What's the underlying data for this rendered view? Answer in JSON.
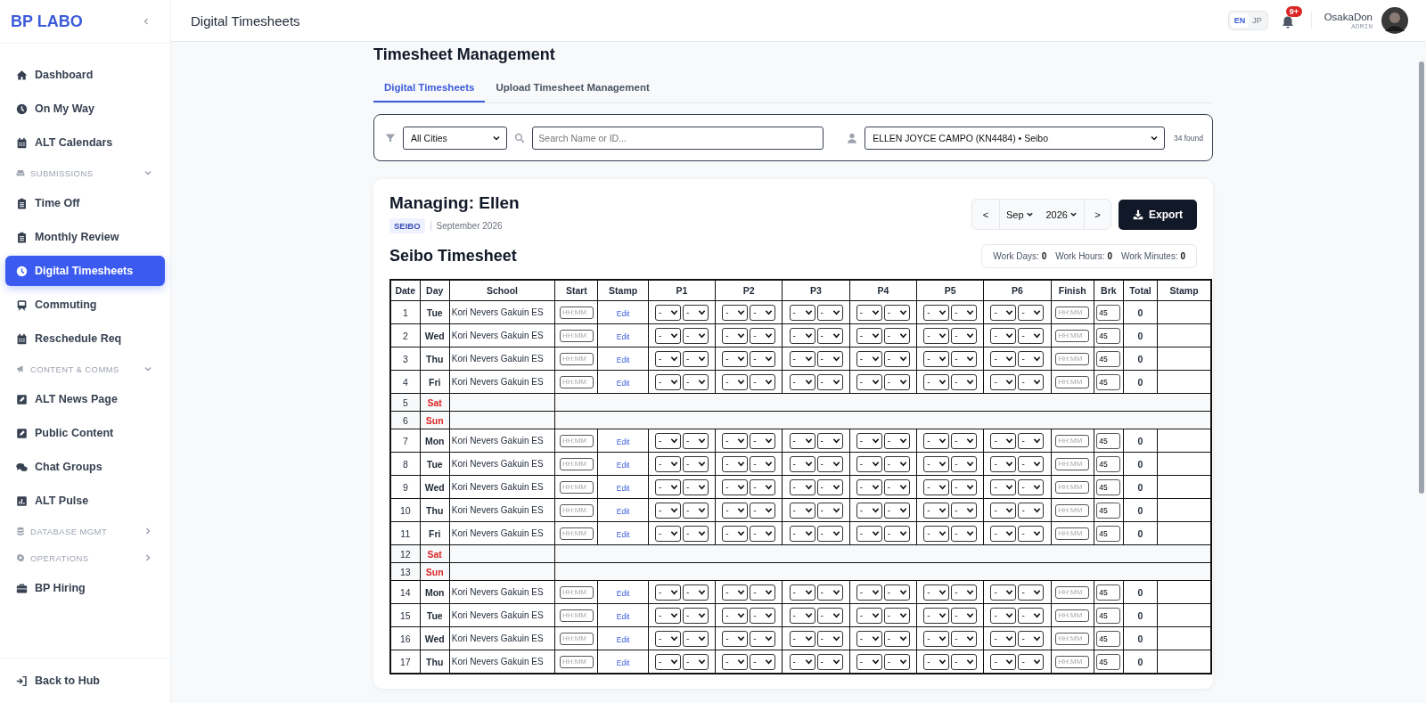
{
  "sidebar": {
    "brand": "BP LABO",
    "items": [
      {
        "kind": "link",
        "label": "Dashboard",
        "selected": false
      },
      {
        "kind": "link",
        "label": "On My Way",
        "selected": false
      },
      {
        "kind": "link",
        "label": "ALT Calendars",
        "selected": false
      },
      {
        "kind": "section",
        "label": "SUBMISSIONS",
        "expanded": true
      },
      {
        "kind": "link",
        "label": "Time Off",
        "selected": false
      },
      {
        "kind": "link",
        "label": "Monthly Review",
        "selected": false
      },
      {
        "kind": "link",
        "label": "Digital Timesheets",
        "selected": true
      },
      {
        "kind": "link",
        "label": "Commuting",
        "selected": false
      },
      {
        "kind": "link",
        "label": "Reschedule Req",
        "selected": false
      },
      {
        "kind": "section",
        "label": "CONTENT & COMMS",
        "expanded": true
      },
      {
        "kind": "link",
        "label": "ALT News Page",
        "selected": false
      },
      {
        "kind": "link",
        "label": "Public Content",
        "selected": false
      },
      {
        "kind": "link",
        "label": "Chat Groups",
        "selected": false
      },
      {
        "kind": "link",
        "label": "ALT Pulse",
        "selected": false
      },
      {
        "kind": "section",
        "label": "DATABASE MGMT",
        "expanded": false
      },
      {
        "kind": "section",
        "label": "OPERATIONS",
        "expanded": false
      },
      {
        "kind": "link",
        "label": "BP Hiring",
        "selected": false
      }
    ],
    "footer": "Back to Hub"
  },
  "header": {
    "title": "Digital Timesheets",
    "languages": [
      {
        "label": "EN",
        "selected": true
      },
      {
        "label": "JP",
        "selected": false
      }
    ],
    "notification_badge": "9+",
    "user": {
      "name": "OsakaDon",
      "role": "ADMIN"
    }
  },
  "page": {
    "title": "Timesheet Management",
    "tabs": [
      {
        "label": "Digital Timesheets",
        "selected": true
      },
      {
        "label": "Upload Timesheet Management",
        "selected": false
      }
    ]
  },
  "filters": {
    "city": "All Cities",
    "search_placeholder": "Search Name or ID...",
    "staff": "ELLEN JOYCE CAMPO (KN4484) • Seibo",
    "count": "34 found"
  },
  "card": {
    "title": "Managing: Ellen",
    "city_tag": "SEIBO",
    "period": "September 2026",
    "nav": {
      "prev": "<",
      "month": "Sep",
      "year": "2026",
      "next": ">"
    },
    "export": "Export",
    "sheet_title": "Seibo Timesheet",
    "stats": [
      {
        "label": "Work Days:",
        "value": "0"
      },
      {
        "label": "Work Hours:",
        "value": "0"
      },
      {
        "label": "Work Minutes:",
        "value": "0"
      }
    ]
  },
  "table": {
    "columns": [
      "Date",
      "Day",
      "School",
      "Start",
      "Stamp",
      "P1",
      "P2",
      "P3",
      "P4",
      "P5",
      "P6",
      "Finish",
      "Brk",
      "Total",
      "Stamp"
    ],
    "rows": [
      {
        "kind": "workday",
        "date": "1",
        "day": "Tue",
        "school": "Kori Nevers Gakuin ES",
        "start_placeholder": "HH:MM",
        "stamp": "Edit",
        "periods": [
          "-",
          "-",
          "-",
          "-",
          "-",
          "-",
          "-",
          "-",
          "-",
          "-",
          "-",
          "-"
        ],
        "finish_placeholder": "HH:MM",
        "break": "45",
        "total": "0"
      },
      {
        "kind": "workday",
        "date": "2",
        "day": "Wed",
        "school": "Kori Nevers Gakuin ES",
        "start_placeholder": "HH:MM",
        "stamp": "Edit",
        "periods": [
          "-",
          "-",
          "-",
          "-",
          "-",
          "-",
          "-",
          "-",
          "-",
          "-",
          "-",
          "-"
        ],
        "finish_placeholder": "HH:MM",
        "break": "45",
        "total": "0"
      },
      {
        "kind": "workday",
        "date": "3",
        "day": "Thu",
        "school": "Kori Nevers Gakuin ES",
        "start_placeholder": "HH:MM",
        "stamp": "Edit",
        "periods": [
          "-",
          "-",
          "-",
          "-",
          "-",
          "-",
          "-",
          "-",
          "-",
          "-",
          "-",
          "-"
        ],
        "finish_placeholder": "HH:MM",
        "break": "45",
        "total": "0"
      },
      {
        "kind": "workday",
        "date": "4",
        "day": "Fri",
        "school": "Kori Nevers Gakuin ES",
        "start_placeholder": "HH:MM",
        "stamp": "Edit",
        "periods": [
          "-",
          "-",
          "-",
          "-",
          "-",
          "-",
          "-",
          "-",
          "-",
          "-",
          "-",
          "-"
        ],
        "finish_placeholder": "HH:MM",
        "break": "45",
        "total": "0"
      },
      {
        "kind": "weekend",
        "date": "5",
        "day": "Sat"
      },
      {
        "kind": "weekend",
        "date": "6",
        "day": "Sun"
      },
      {
        "kind": "workday",
        "date": "7",
        "day": "Mon",
        "school": "Kori Nevers Gakuin ES",
        "start_placeholder": "HH:MM",
        "stamp": "Edit",
        "periods": [
          "-",
          "-",
          "-",
          "-",
          "-",
          "-",
          "-",
          "-",
          "-",
          "-",
          "-",
          "-"
        ],
        "finish_placeholder": "HH:MM",
        "break": "45",
        "total": "0"
      },
      {
        "kind": "workday",
        "date": "8",
        "day": "Tue",
        "school": "Kori Nevers Gakuin ES",
        "start_placeholder": "HH:MM",
        "stamp": "Edit",
        "periods": [
          "-",
          "-",
          "-",
          "-",
          "-",
          "-",
          "-",
          "-",
          "-",
          "-",
          "-",
          "-"
        ],
        "finish_placeholder": "HH:MM",
        "break": "45",
        "total": "0"
      },
      {
        "kind": "workday",
        "date": "9",
        "day": "Wed",
        "school": "Kori Nevers Gakuin ES",
        "start_placeholder": "HH:MM",
        "stamp": "Edit",
        "periods": [
          "-",
          "-",
          "-",
          "-",
          "-",
          "-",
          "-",
          "-",
          "-",
          "-",
          "-",
          "-"
        ],
        "finish_placeholder": "HH:MM",
        "break": "45",
        "total": "0"
      },
      {
        "kind": "workday",
        "date": "10",
        "day": "Thu",
        "school": "Kori Nevers Gakuin ES",
        "start_placeholder": "HH:MM",
        "stamp": "Edit",
        "periods": [
          "-",
          "-",
          "-",
          "-",
          "-",
          "-",
          "-",
          "-",
          "-",
          "-",
          "-",
          "-"
        ],
        "finish_placeholder": "HH:MM",
        "break": "45",
        "total": "0"
      },
      {
        "kind": "workday",
        "date": "11",
        "day": "Fri",
        "school": "Kori Nevers Gakuin ES",
        "start_placeholder": "HH:MM",
        "stamp": "Edit",
        "periods": [
          "-",
          "-",
          "-",
          "-",
          "-",
          "-",
          "-",
          "-",
          "-",
          "-",
          "-",
          "-"
        ],
        "finish_placeholder": "HH:MM",
        "break": "45",
        "total": "0"
      },
      {
        "kind": "weekend",
        "date": "12",
        "day": "Sat"
      },
      {
        "kind": "weekend",
        "date": "13",
        "day": "Sun"
      },
      {
        "kind": "workday",
        "date": "14",
        "day": "Mon",
        "school": "Kori Nevers Gakuin ES",
        "start_placeholder": "HH:MM",
        "stamp": "Edit",
        "periods": [
          "-",
          "-",
          "-",
          "-",
          "-",
          "-",
          "-",
          "-",
          "-",
          "-",
          "-",
          "-"
        ],
        "finish_placeholder": "HH:MM",
        "break": "45",
        "total": "0"
      },
      {
        "kind": "workday",
        "date": "15",
        "day": "Tue",
        "school": "Kori Nevers Gakuin ES",
        "start_placeholder": "HH:MM",
        "stamp": "Edit",
        "periods": [
          "-",
          "-",
          "-",
          "-",
          "-",
          "-",
          "-",
          "-",
          "-",
          "-",
          "-",
          "-"
        ],
        "finish_placeholder": "HH:MM",
        "break": "45",
        "total": "0"
      },
      {
        "kind": "workday",
        "date": "16",
        "day": "Wed",
        "school": "Kori Nevers Gakuin ES",
        "start_placeholder": "HH:MM",
        "stamp": "Edit",
        "periods": [
          "-",
          "-",
          "-",
          "-",
          "-",
          "-",
          "-",
          "-",
          "-",
          "-",
          "-",
          "-"
        ],
        "finish_placeholder": "HH:MM",
        "break": "45",
        "total": "0"
      },
      {
        "kind": "workday",
        "date": "17",
        "day": "Thu",
        "school": "Kori Nevers Gakuin ES",
        "start_placeholder": "HH:MM",
        "stamp": "Edit",
        "periods": [
          "-",
          "-",
          "-",
          "-",
          "-",
          "-",
          "-",
          "-",
          "-",
          "-",
          "-",
          "-"
        ],
        "finish_placeholder": "HH:MM",
        "break": "45",
        "total": "0"
      }
    ]
  }
}
